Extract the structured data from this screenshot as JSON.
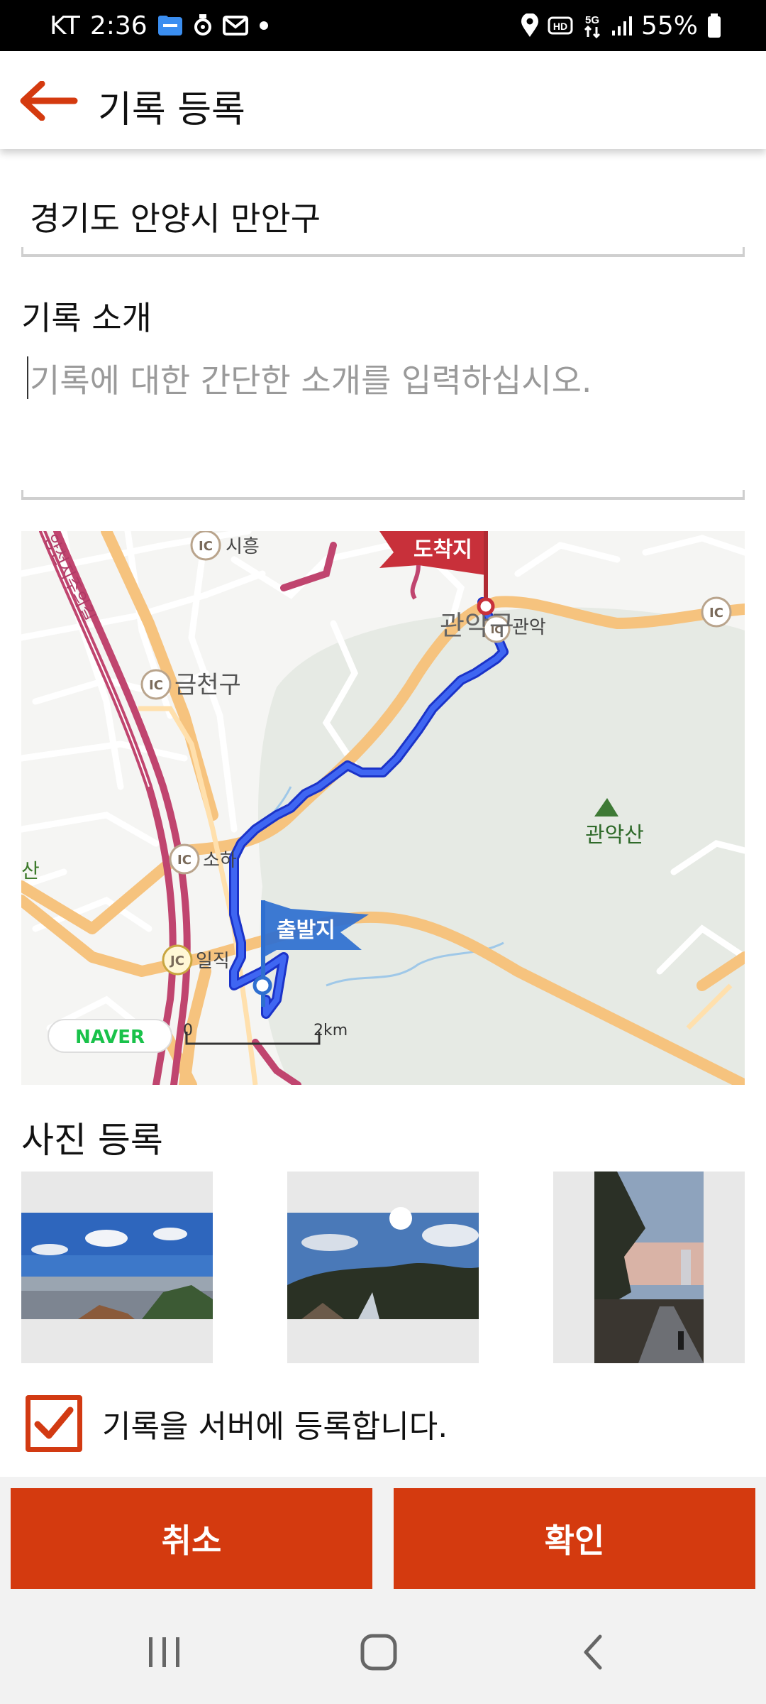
{
  "status_bar": {
    "carrier": "KT",
    "time": "2:36",
    "battery": "55%"
  },
  "header": {
    "title": "기록 등록"
  },
  "form": {
    "location": "경기도 안양시 만안구",
    "intro_label": "기록 소개",
    "intro_placeholder": "기록에 대한 간단한 소개를 입력하십시오."
  },
  "map": {
    "end_label": "도착지",
    "start_label": "출발지",
    "peak_label": "관악산",
    "places": [
      "시흥",
      "금천구",
      "소하",
      "일직",
      "관악구",
      "관악"
    ],
    "road_label": "양천지주의길",
    "scale_start": "0",
    "scale_end": "2km",
    "brand": "NAVER",
    "left_edge_label": "산",
    "ic_badge": "IC",
    "jc_badge": "JC",
    "route_color": "#2f4fe0",
    "flag_end_color": "#c8303a",
    "flag_start_color": "#2e6fd0"
  },
  "photos": {
    "label": "사진 등록",
    "count": 3
  },
  "register": {
    "checked": true,
    "label": "기록을 서버에 등록합니다."
  },
  "buttons": {
    "cancel": "취소",
    "confirm": "확인"
  },
  "colors": {
    "accent": "#d43a0f"
  }
}
